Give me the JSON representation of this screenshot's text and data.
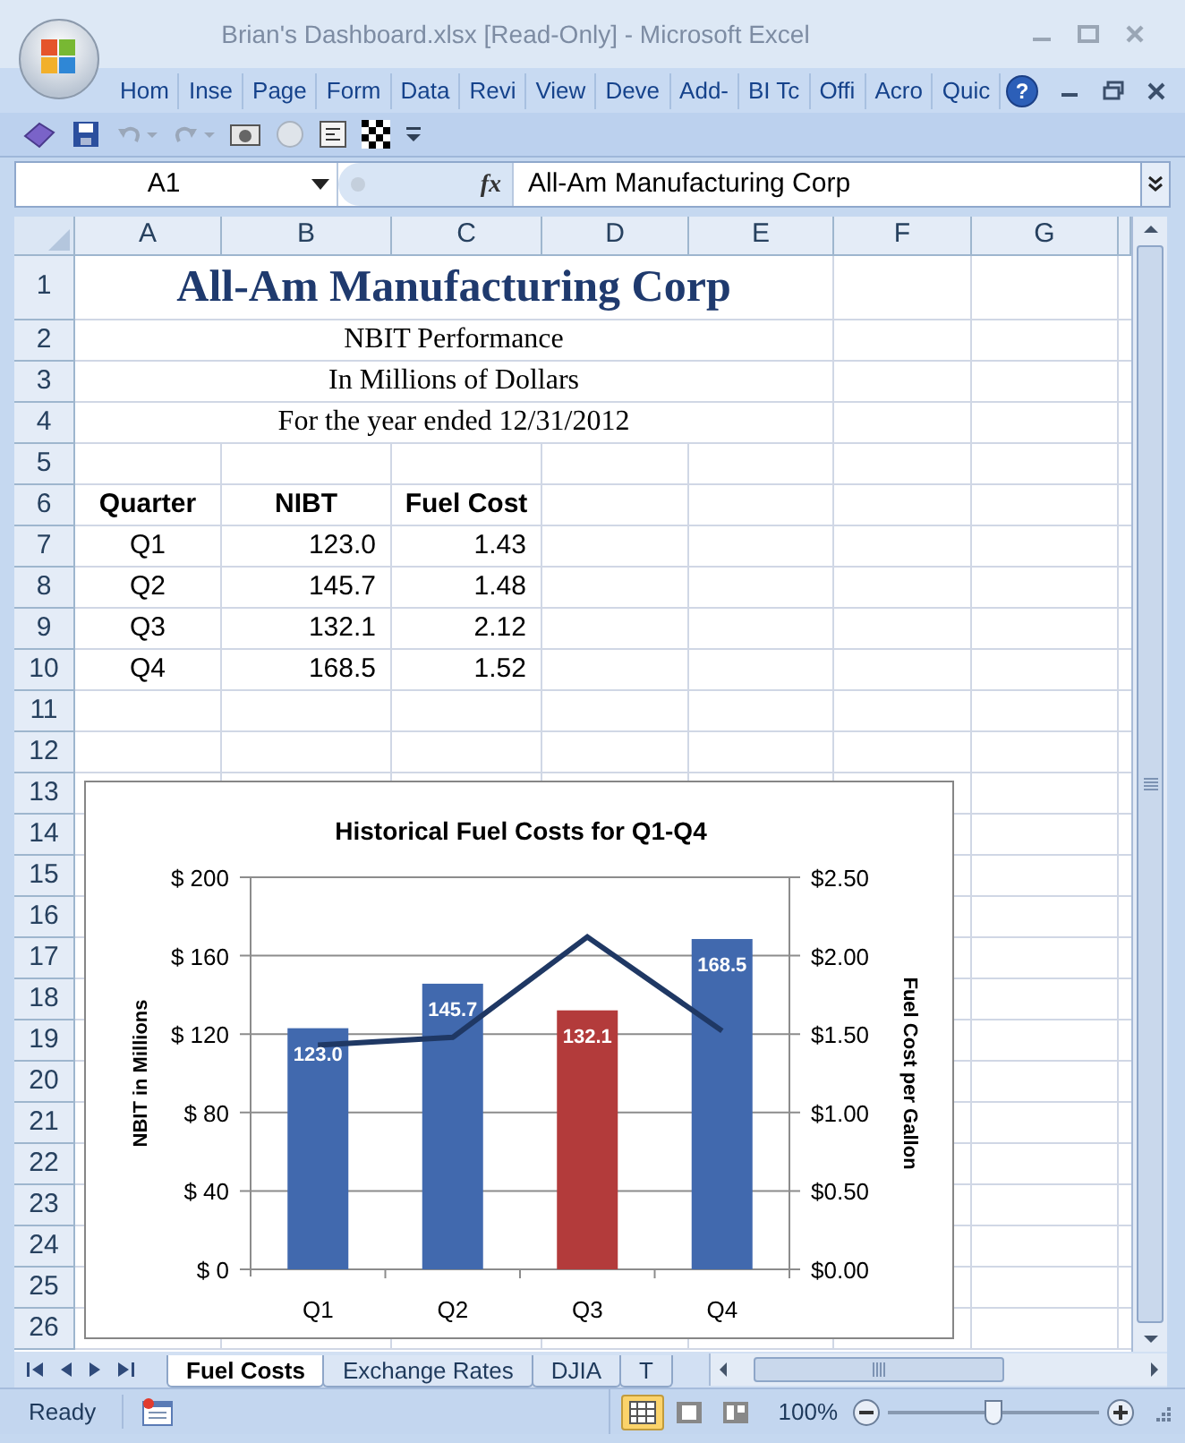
{
  "window": {
    "title": "Brian's Dashboard.xlsx  [Read-Only] - Microsoft Excel"
  },
  "help_label": "?",
  "ribbon_tabs": [
    "Hom",
    "Inse",
    "Page",
    "Form",
    "Data",
    "Revi",
    "View",
    "Deve",
    "Add-",
    "BI Tc",
    "Offi",
    "Acro",
    "Quic"
  ],
  "formula_bar": {
    "name_box": "A1",
    "function_label": "fx",
    "formula": "All-Am Manufacturing Corp"
  },
  "columns": [
    "A",
    "B",
    "C",
    "D",
    "E",
    "F",
    "G"
  ],
  "row_numbers": [
    "1",
    "2",
    "3",
    "4",
    "5",
    "6",
    "7",
    "8",
    "9",
    "10",
    "11",
    "12",
    "13",
    "14",
    "15",
    "16",
    "17",
    "18",
    "19",
    "20",
    "21",
    "22",
    "23",
    "24",
    "25",
    "26"
  ],
  "sheet": {
    "title": "All-Am Manufacturing Corp",
    "subtitles": [
      "NBIT Performance",
      "In Millions of Dollars",
      "For the year ended 12/31/2012"
    ],
    "table": {
      "columns": [
        "Quarter",
        "NIBT",
        "Fuel Cost"
      ],
      "rows": [
        [
          "Q1",
          "123.0",
          "1.43"
        ],
        [
          "Q2",
          "145.7",
          "1.48"
        ],
        [
          "Q3",
          "132.1",
          "2.12"
        ],
        [
          "Q4",
          "168.5",
          "1.52"
        ]
      ]
    }
  },
  "chart": {
    "chart_data": {
      "type": "bar",
      "title": "Historical Fuel Costs for Q1-Q4",
      "ylabel": "NBIT in Millions",
      "y2label": "Fuel Cost per Gallon",
      "categories": [
        "Q1",
        "Q2",
        "Q3",
        "Q4"
      ],
      "series": [
        {
          "color": "#4169ae",
          "values": [
            123.0,
            145.7,
            null,
            168.5
          ]
        },
        {
          "color": "#b33b3b",
          "values": [
            null,
            null,
            132.1,
            null
          ]
        },
        {
          "type": "line",
          "axis": "y2",
          "color": "#1f3864",
          "values": [
            1.43,
            1.48,
            2.12,
            1.52
          ]
        }
      ],
      "ylim": [
        0,
        200
      ],
      "yticks": [
        {
          "value": 0,
          "label": "$ 0"
        },
        {
          "value": 40,
          "label": "$ 40"
        },
        {
          "value": 80,
          "label": "$ 80"
        },
        {
          "value": 120,
          "label": "$ 120"
        },
        {
          "value": 160,
          "label": "$ 160"
        },
        {
          "value": 200,
          "label": "$ 200"
        }
      ],
      "y2lim": [
        0,
        2.5
      ],
      "y2ticks": [
        {
          "value": 0,
          "label": "$0.00"
        },
        {
          "value": 0.5,
          "label": "$0.50"
        },
        {
          "value": 1,
          "label": "$1.00"
        },
        {
          "value": 1.5,
          "label": "$1.50"
        },
        {
          "value": 2,
          "label": "$2.00"
        },
        {
          "value": 2.5,
          "label": "$2.50"
        }
      ],
      "grid": true,
      "value_labels": [
        "123.0",
        "145.7",
        "132.1",
        "168.5"
      ]
    }
  },
  "sheet_tabs": [
    {
      "label": "Fuel Costs",
      "selected": true
    },
    {
      "label": "Exchange Rates",
      "selected": false
    },
    {
      "label": "DJIA",
      "selected": false
    },
    {
      "label": "T",
      "selected": false
    }
  ],
  "status_bar": {
    "mode": "Ready",
    "zoom": "100%",
    "zoom_slider": {
      "level": 0.5
    },
    "views": [
      {
        "kind": "normal",
        "selected": true
      },
      {
        "kind": "page-layout",
        "selected": false
      },
      {
        "kind": "page-break",
        "selected": false
      }
    ]
  }
}
